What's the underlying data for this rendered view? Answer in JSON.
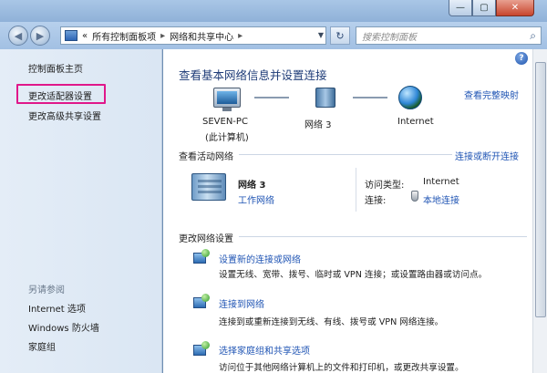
{
  "window": {
    "minimize_glyph": "—",
    "maximize_glyph": "▢",
    "close_glyph": "✕"
  },
  "toolbar": {
    "back_glyph": "◀",
    "forward_glyph": "▶",
    "crumb_sep": "«",
    "crumb_root": "所有控制面板项",
    "crumb_arrow1": "▸",
    "crumb_current": "网络和共享中心",
    "crumb_arrow2": "▸",
    "refresh_glyph": "↻",
    "search_placeholder": "搜索控制面板",
    "search_glyph": "⌕"
  },
  "sidebar": {
    "items": [
      {
        "label": "控制面板主页"
      },
      {
        "label": "更改适配器设置"
      },
      {
        "label": "更改高级共享设置"
      }
    ],
    "see_also_title": "另请参阅",
    "see_also": [
      {
        "label": "Internet 选项"
      },
      {
        "label": "Windows 防火墙"
      },
      {
        "label": "家庭组"
      }
    ]
  },
  "main": {
    "title": "查看基本网络信息并设置连接",
    "view_full_map": "查看完整映射",
    "map": {
      "computer_name": "SEVEN-PC",
      "computer_sub": "(此计算机)",
      "network": "网络  3",
      "internet": "Internet"
    },
    "active_title": "查看活动网络",
    "connect_disconnect": "连接或断开连接",
    "active": {
      "name": "网络  3",
      "type_link": "工作网络",
      "access_label": "访问类型:",
      "access_value": "Internet",
      "conn_label": "连接:",
      "conn_value": "本地连接"
    },
    "change_title": "更改网络设置",
    "tasks": [
      {
        "title": "设置新的连接或网络",
        "desc": "设置无线、宽带、拨号、临时或 VPN 连接；或设置路由器或访问点。"
      },
      {
        "title": "连接到网络",
        "desc": "连接到或重新连接到无线、有线、拨号或 VPN 网络连接。"
      },
      {
        "title": "选择家庭组和共享选项",
        "desc": "访问位于其他网络计算机上的文件和打印机，或更改共享设置。"
      }
    ],
    "help_glyph": "?"
  }
}
